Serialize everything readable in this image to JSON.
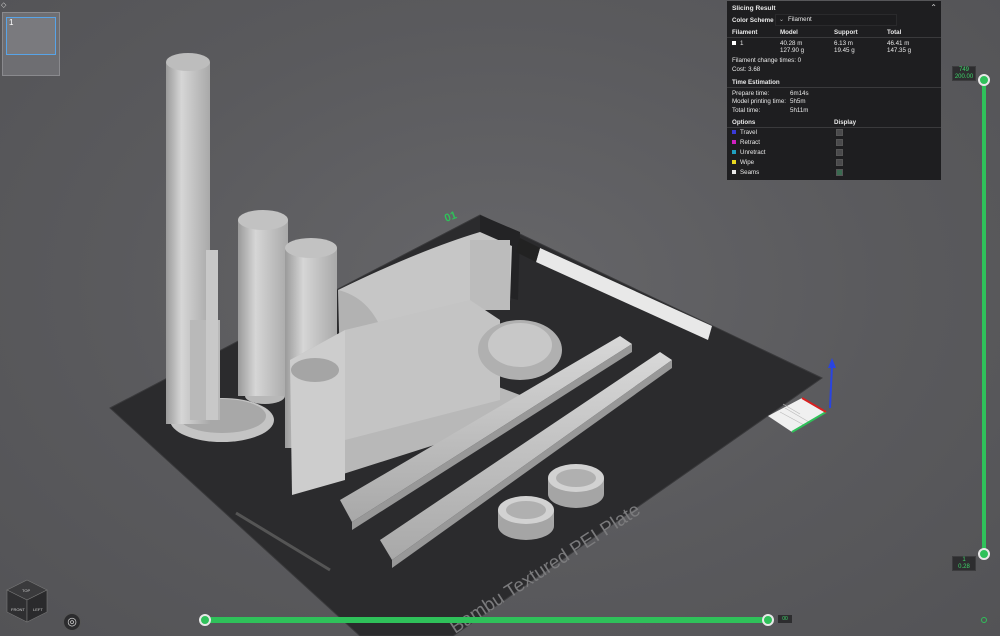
{
  "plate": {
    "number": "01",
    "label": "Bambu Textured PEI Plate"
  },
  "thumbnail": {
    "index": "1"
  },
  "slicing": {
    "title": "Slicing Result",
    "color_scheme_label": "Color Scheme",
    "color_scheme_value": "Filament",
    "headers": {
      "filament": "Filament",
      "model": "Model",
      "support": "Support",
      "total": "Total"
    },
    "rows": [
      {
        "id": "1",
        "model_len": "40.28 m",
        "model_wt": "127.90 g",
        "support_len": "6.13 m",
        "support_wt": "19.45 g",
        "total_len": "46.41 m",
        "total_wt": "147.35 g"
      }
    ],
    "filament_change": "Filament change times:  0",
    "cost": "Cost:  3.68",
    "time_title": "Time Estimation",
    "prepare_label": "Prepare time:",
    "prepare_val": "6m14s",
    "model_time_label": "Model printing time:",
    "model_time_val": "5h5m",
    "total_time_label": "Total time:",
    "total_time_val": "5h11m",
    "options_label": "Options",
    "display_label": "Display",
    "options": [
      {
        "label": "Travel",
        "color": "#3a3ad8"
      },
      {
        "label": "Retract",
        "color": "#d020c0"
      },
      {
        "label": "Unretract",
        "color": "#20a0c0"
      },
      {
        "label": "Wipe",
        "color": "#e8d820"
      },
      {
        "label": "Seams",
        "color": "#e8e8e8"
      }
    ]
  },
  "layer_slider": {
    "top_label_1": "749",
    "top_label_2": "200.00",
    "bottom_label_1": "1",
    "bottom_label_2": "0.28"
  },
  "horizontal_slider": {
    "label": "00"
  },
  "navcube": {
    "top": "TOP",
    "front": "FRONT",
    "left": "LEFT"
  },
  "colors": {
    "accent": "#2fc15a",
    "panel_bg": "#1c1c1e",
    "bed": "#2b2b2d",
    "model": "#c9c9c9"
  }
}
